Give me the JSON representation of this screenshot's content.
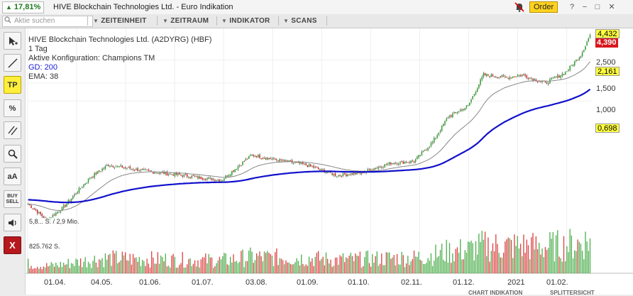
{
  "titlebar": {
    "change": "17,81%",
    "name": "HIVE Blockchain Technologies Ltd. - Euro Indikation",
    "order_label": "Order",
    "help": "?",
    "minimize": "−",
    "maximize": "□",
    "close": "✕"
  },
  "toolbar": {
    "search_placeholder": "Aktie suchen",
    "menus": [
      "ZEITEINHEIT",
      "ZEITRAUM",
      "INDIKATOR",
      "SCANS"
    ]
  },
  "side_tools": {
    "tp": "TP",
    "percent": "%",
    "text": "aA",
    "buy": "BUY",
    "sell": "SELL",
    "close": "X"
  },
  "chart": {
    "title": "HIVE Blockchain Technologies Ltd. (A2DYRG) (HBF)",
    "period": "1 Tag",
    "config": "Aktive Konfiguration: Champions TM",
    "gd": "GD: 200",
    "ema": "EMA: 38",
    "volume_high": "5,8... S. / 2,9 Mio.",
    "volume_low": "825.762 S.",
    "price_labels": {
      "high": "4,432",
      "last": "4,390",
      "ema": "2,161",
      "gd": "0,698"
    },
    "yticks": [
      "2,500",
      "1,500",
      "1,000"
    ],
    "xlabels": [
      "01.04.",
      "04.05.",
      "01.06.",
      "01.07.",
      "03.08.",
      "01.09.",
      "01.10.",
      "02.11.",
      "01.12.",
      "2021",
      "01.02."
    ],
    "subtabs": [
      "CHART INDIKATION",
      "SPLITTERSICHT"
    ],
    "colors": {
      "up": "#2ca02c",
      "down": "#d62020",
      "gd": "#1010cc",
      "ema": "#888888"
    }
  },
  "chart_data": {
    "type": "candlestick",
    "title": "HIVE Blockchain Technologies Ltd. (A2DYRG) (HBF)",
    "scale": "log",
    "yticks": [
      1000,
      1500,
      2500
    ],
    "xlabels": [
      "01.04.",
      "04.05.",
      "01.06.",
      "01.07.",
      "03.08.",
      "01.09.",
      "01.10.",
      "02.11.",
      "01.12.",
      "2021",
      "01.02."
    ],
    "close_anchors": [
      {
        "d": 0,
        "c": 0.1
      },
      {
        "d": 12,
        "c": 0.07
      },
      {
        "d": 22,
        "c": 0.09
      },
      {
        "d": 40,
        "c": 0.18
      },
      {
        "d": 52,
        "c": 0.24
      },
      {
        "d": 75,
        "c": 0.21
      },
      {
        "d": 100,
        "c": 0.19
      },
      {
        "d": 125,
        "c": 0.17
      },
      {
        "d": 145,
        "c": 0.3
      },
      {
        "d": 160,
        "c": 0.27
      },
      {
        "d": 180,
        "c": 0.24
      },
      {
        "d": 200,
        "c": 0.19
      },
      {
        "d": 215,
        "c": 0.2
      },
      {
        "d": 235,
        "c": 0.25
      },
      {
        "d": 250,
        "c": 0.26
      },
      {
        "d": 262,
        "c": 0.4
      },
      {
        "d": 272,
        "c": 0.7
      },
      {
        "d": 285,
        "c": 0.9
      },
      {
        "d": 295,
        "c": 1.8
      },
      {
        "d": 310,
        "c": 1.7
      },
      {
        "d": 320,
        "c": 1.8
      },
      {
        "d": 335,
        "c": 1.5
      },
      {
        "d": 348,
        "c": 1.9
      },
      {
        "d": 358,
        "c": 2.8
      },
      {
        "d": 364,
        "c": 4.39
      }
    ],
    "ema_period": 38,
    "gd_period": 200,
    "last_values": {
      "high": 4.432,
      "last": 4.39,
      "ema": 2.161,
      "gd": 0.698
    },
    "volume_labels": {
      "max": "5,8 Mio. S.",
      "mid": "2,9 Mio.",
      "low": "825.762 S."
    }
  }
}
